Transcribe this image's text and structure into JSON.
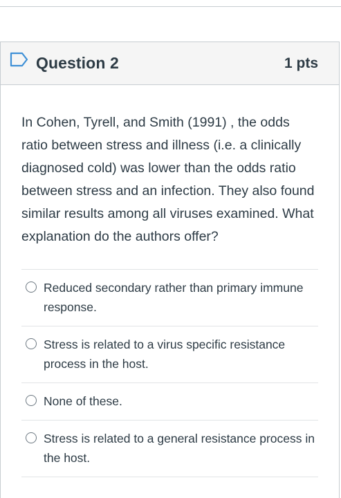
{
  "question": {
    "title": "Question 2",
    "points": "1 pts",
    "text": "In Cohen, Tyrell, and Smith (1991) , the odds ratio between stress and illness (i.e. a clinically diagnosed cold) was lower than the odds ratio between stress and an infection. They also found similar results among all viruses examined. What explanation do the authors offer?",
    "flag_icon": "flag-icon",
    "answers": [
      {
        "label": "Reduced secondary rather than primary immune response."
      },
      {
        "label": "Stress is related to a virus specific resistance process in the host."
      },
      {
        "label": "None of these."
      },
      {
        "label": "Stress is related to a general resistance process in the host."
      }
    ]
  },
  "colors": {
    "header_bg": "#f5f5f5",
    "border": "#c7cdd1",
    "text": "#2d3b45",
    "flag_accent": "#3d8fd6"
  }
}
